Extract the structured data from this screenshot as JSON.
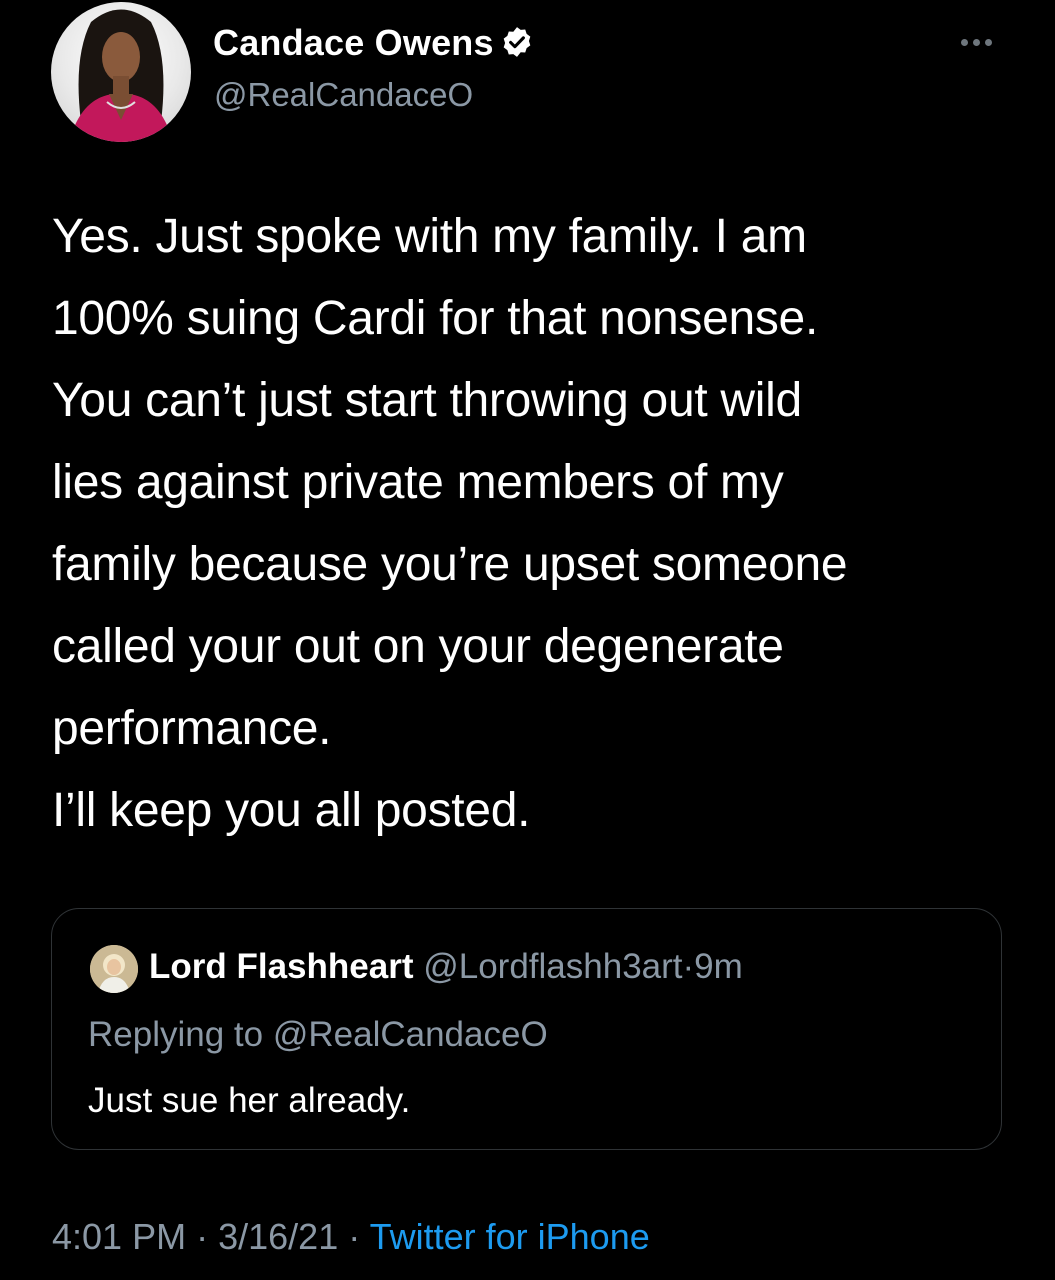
{
  "author": {
    "display_name": "Candace Owens",
    "handle": "@RealCandaceO",
    "verified": true
  },
  "tweet": {
    "lines": [
      "Yes. Just spoke with my family. I am",
      "100% suing Cardi for that nonsense.",
      "You can’t just start throwing out wild",
      "lies against private members of my",
      "family because you’re upset someone",
      "called your out on your degenerate",
      "performance.",
      "I’ll keep you all posted."
    ]
  },
  "quoted_tweet": {
    "display_name": "Lord Flashheart",
    "handle": "@Lordflashh3art",
    "separator": "·",
    "age": "9m",
    "replying_to": "Replying to @RealCandaceO",
    "text": "Just sue her already."
  },
  "footer": {
    "time": "4:01 PM",
    "separator": "·",
    "date": "3/16/21",
    "source": "Twitter for iPhone"
  },
  "colors": {
    "background": "#000000",
    "text": "#ffffff",
    "secondary_text": "#8b98a5",
    "link": "#1d9bf0",
    "border": "#2f3336"
  },
  "icons": {
    "verified": "verified-badge-icon",
    "more": "more-options-icon"
  }
}
